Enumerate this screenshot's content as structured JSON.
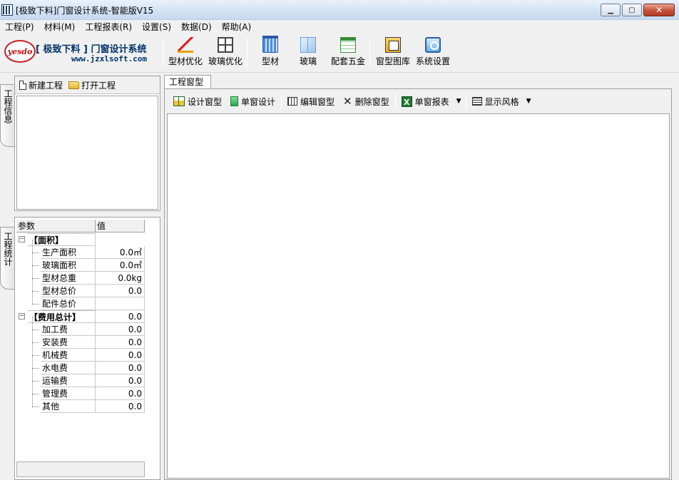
{
  "window": {
    "title": "[极致下料]门窗设计系统-智能版V15",
    "controls": {
      "minimize": "▁",
      "restore": "▢",
      "close": "✕"
    }
  },
  "menu": [
    {
      "label": "工程(P)"
    },
    {
      "label": "材料(M)"
    },
    {
      "label": "工程报表(R)"
    },
    {
      "label": "设置(S)"
    },
    {
      "label": "数据(D)"
    },
    {
      "label": "帮助(A)"
    }
  ],
  "logo": {
    "mark": "yesdo",
    "name": "[ 极致下料 ] 门窗设计系统",
    "url": "www.jzxlsoft.com"
  },
  "toolbar": {
    "profile_opt": "型材优化",
    "glass_opt": "玻璃优化",
    "profile": "型材",
    "glass": "玻璃",
    "hardware": "配套五金",
    "window_library": "窗型图库",
    "system_settings": "系统设置"
  },
  "side_tabs": {
    "project_info": "工程信息",
    "project_stats": "工程统计"
  },
  "project_panel": {
    "new_project": "新建工程",
    "open_project": "打开工程"
  },
  "stats_grid": {
    "headers": {
      "param": "参数",
      "value": "值"
    },
    "area_group": {
      "name": "【面积】",
      "toggle": "−"
    },
    "production_area": {
      "name": "生产面积",
      "value": "0.0㎡"
    },
    "glass_area": {
      "name": "玻璃面积",
      "value": "0.0㎡"
    },
    "profile_weight": {
      "name": "型材总重",
      "value": "0.0kg"
    },
    "profile_price": {
      "name": "型材总价",
      "value": "0.0"
    },
    "fitting_price": {
      "name": "配件总价",
      "value": ""
    },
    "cost_group": {
      "name": "【费用总计】",
      "value": "0.0",
      "toggle": "−"
    },
    "processing": {
      "name": "加工费",
      "value": "0.0"
    },
    "installation": {
      "name": "安装费",
      "value": "0.0"
    },
    "machinery": {
      "name": "机械费",
      "value": "0.0"
    },
    "utilities": {
      "name": "水电费",
      "value": "0.0"
    },
    "transport": {
      "name": "运输费",
      "value": "0.0"
    },
    "management": {
      "name": "管理费",
      "value": "0.0"
    },
    "other": {
      "name": "其他",
      "value": "0.0"
    }
  },
  "main": {
    "tab": "工程窗型",
    "design_window": "设计窗型",
    "single_design": "单窗设计",
    "edit_window": "编辑窗型",
    "delete_window": "删除窗型",
    "single_report": "单窗报表",
    "display_style": "显示风格",
    "dropdown_arrow": "▼",
    "report_glyph": "X",
    "delete_glyph": "✕"
  }
}
